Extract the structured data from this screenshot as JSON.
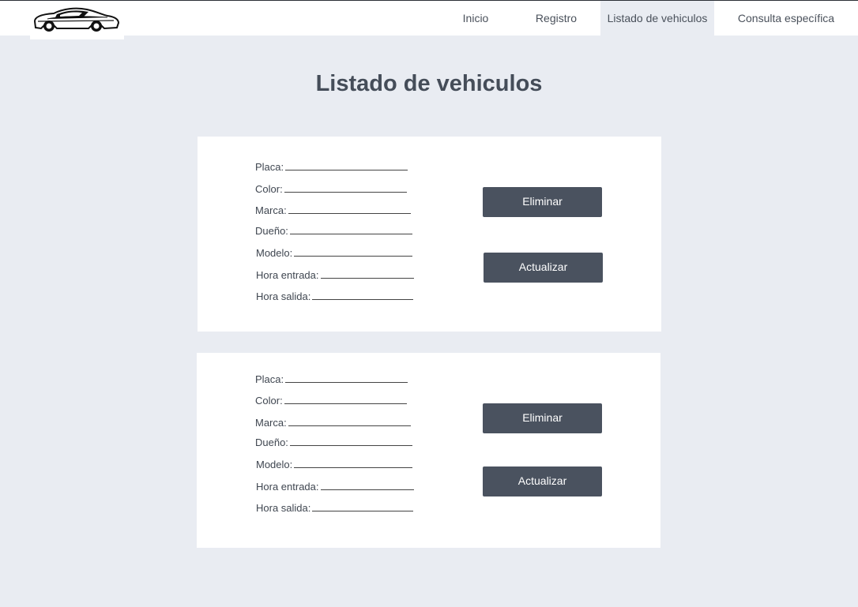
{
  "nav": {
    "items": [
      {
        "label": "Inicio"
      },
      {
        "label": "Registro"
      },
      {
        "label": "Listado de vehiculos",
        "active": true
      },
      {
        "label": "Consulta específica"
      }
    ]
  },
  "page": {
    "title": "Listado de vehiculos"
  },
  "cards": [
    {
      "fields": {
        "placa": "Placa:",
        "color": "Color:",
        "marca": "Marca:",
        "dueno": "Dueño:",
        "modelo": "Modelo:",
        "hora_entrada": "Hora entrada:",
        "hora_salida": "Hora salida:"
      },
      "delete_label": "Eliminar",
      "update_label": "Actualizar"
    },
    {
      "fields": {
        "placa": "Placa:",
        "color": "Color:",
        "marca": "Marca:",
        "dueno": "Dueño:",
        "modelo": "Modelo:",
        "hora_entrada": "Hora entrada:",
        "hora_salida": "Hora salida:"
      },
      "delete_label": "Eliminar",
      "update_label": "Actualizar"
    }
  ],
  "colors": {
    "background": "#e9ecf2",
    "button": "#4a525f",
    "active_nav": "#e9ecf2"
  },
  "icons": {
    "logo": "sports-car-icon"
  }
}
